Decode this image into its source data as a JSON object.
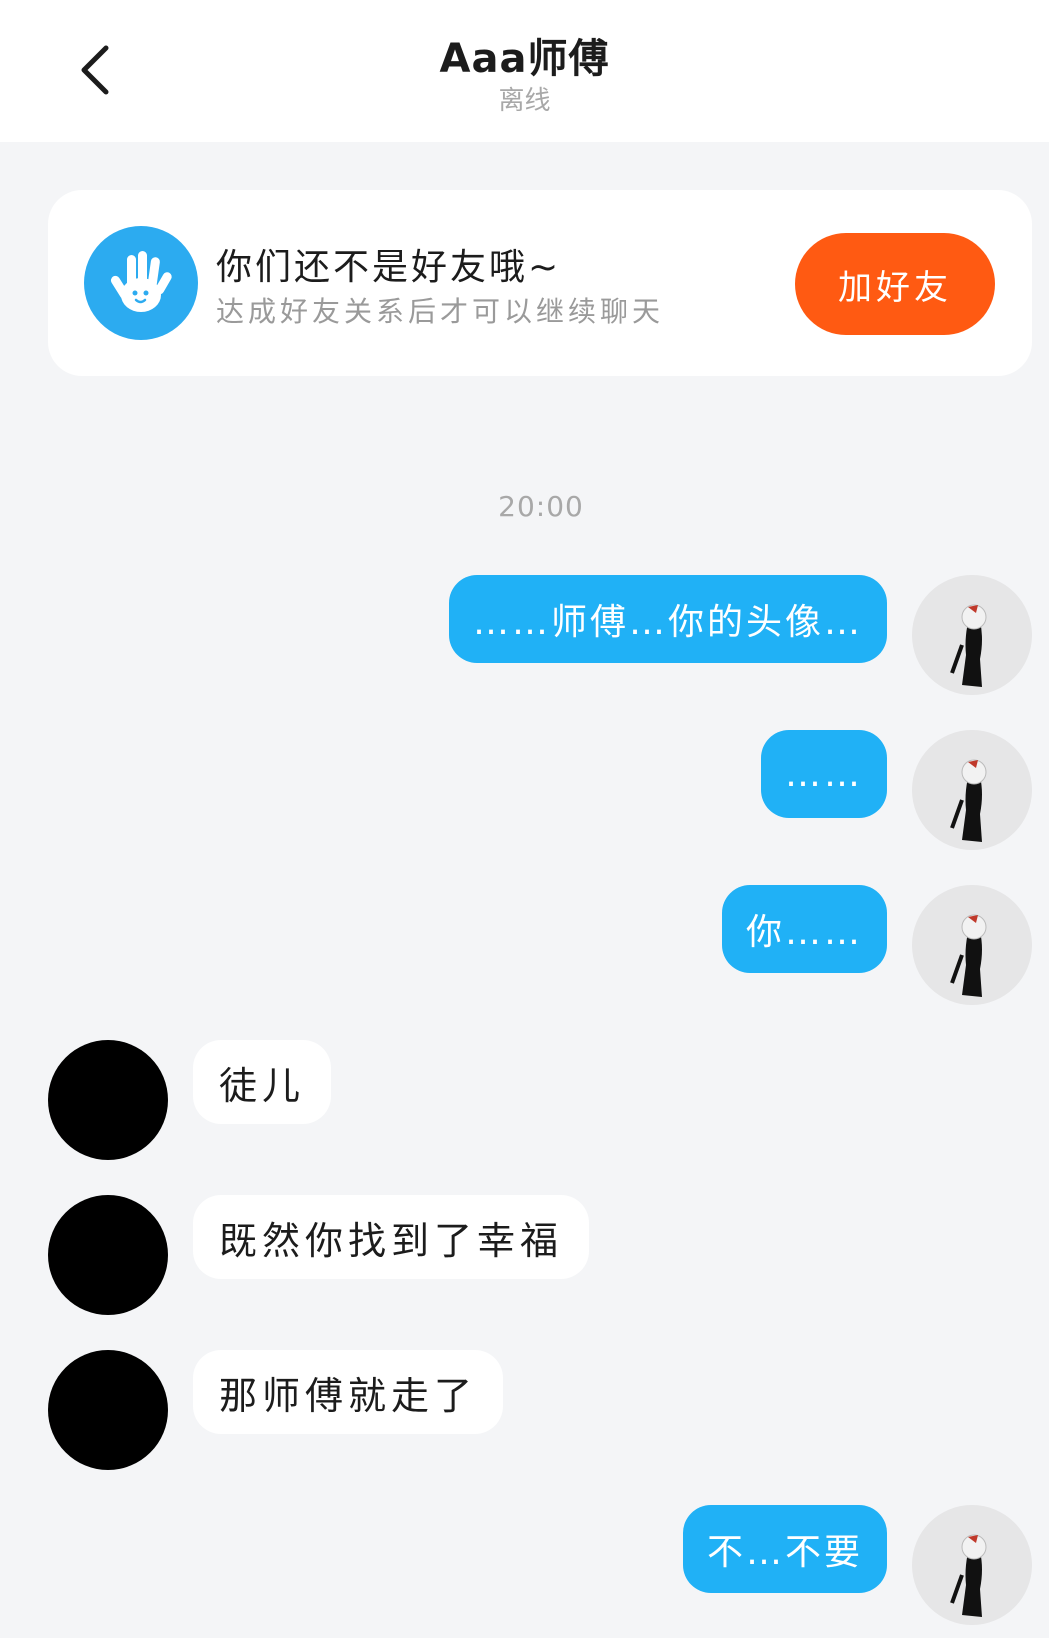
{
  "header": {
    "title": "Aaa师傅",
    "status": "离线"
  },
  "friend_card": {
    "title": "你们还不是好友哦~",
    "subtitle": "达成好友关系后才可以继续聊天",
    "button_label": "加好友"
  },
  "chat": {
    "timestamp": "20:00",
    "messages": [
      {
        "side": "right",
        "text": "……师傅…你的头像…"
      },
      {
        "side": "right",
        "text": "……"
      },
      {
        "side": "right",
        "text": "你……"
      },
      {
        "side": "left",
        "text": "徒儿"
      },
      {
        "side": "left",
        "text": "既然你找到了幸福"
      },
      {
        "side": "left",
        "text": "那师傅就走了"
      },
      {
        "side": "right",
        "text": "不…不要"
      }
    ]
  },
  "colors": {
    "sent_bubble": "#20b1f6",
    "add_button": "#ff5a12",
    "hand_icon_bg": "#2cabf0"
  }
}
